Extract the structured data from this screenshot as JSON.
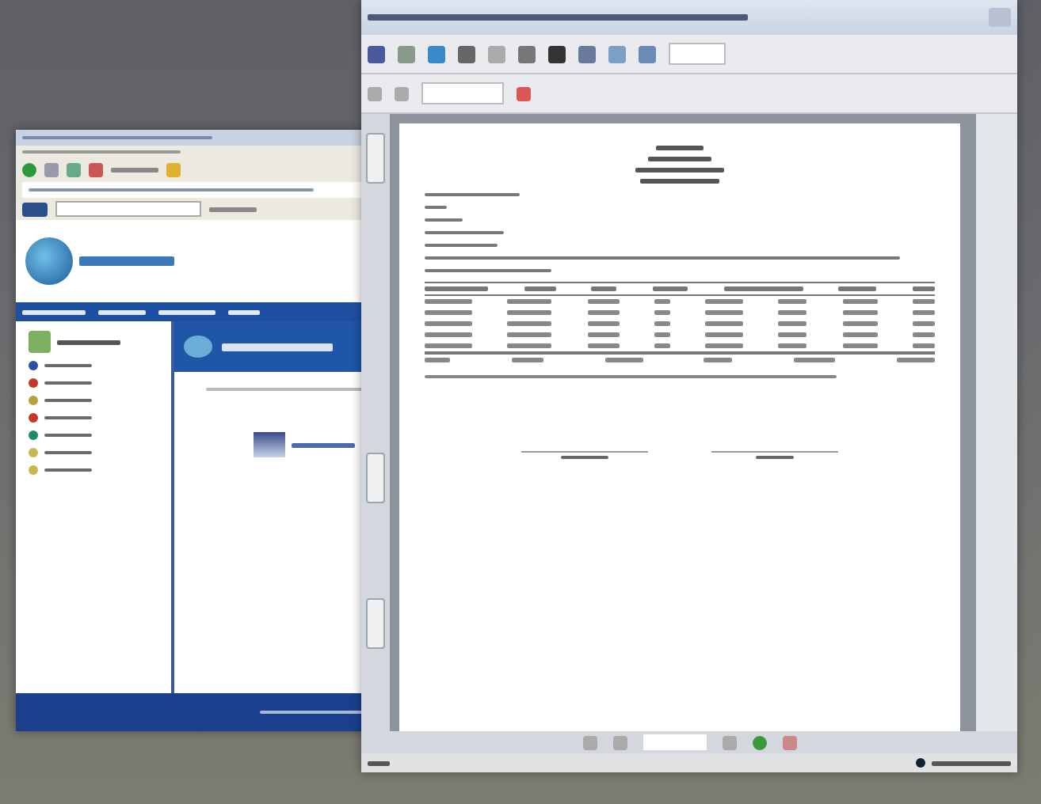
{
  "browser_window": {
    "sidebar_items": [
      {
        "color": "#2a4fa8"
      },
      {
        "color": "#c0392b"
      },
      {
        "color": "#b8a040"
      },
      {
        "color": "#c0392b"
      },
      {
        "color": "#1f8a6a"
      },
      {
        "color": "#c8b850"
      },
      {
        "color": "#c8b850"
      }
    ]
  },
  "pdf_window": {
    "report_rows": [
      {
        "kind": "header"
      },
      {
        "kind": "data"
      },
      {
        "kind": "data"
      },
      {
        "kind": "data"
      },
      {
        "kind": "data"
      },
      {
        "kind": "data"
      },
      {
        "kind": "total"
      }
    ]
  }
}
